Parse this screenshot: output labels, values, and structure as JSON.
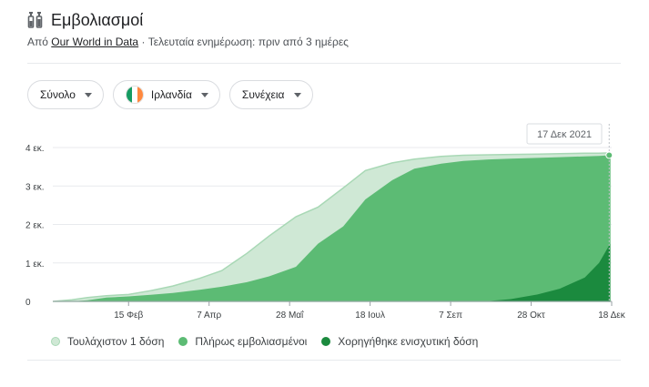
{
  "header": {
    "title": "Εμβολιασμοί",
    "subtitle_prefix": "Από ",
    "source_link": "Our World in Data",
    "subtitle_suffix": " · Τελευταία ενημέρωση: πριν από 3 ημέρες"
  },
  "controls": {
    "metric": "Σύνολο",
    "country": "Ιρλανδία",
    "mode": "Συνέχεια"
  },
  "colors": {
    "at_least_one": "#cfe8d5",
    "at_least_one_stroke": "#a8d8b5",
    "fully": "#5cbb74",
    "booster": "#1b8a3e"
  },
  "chart_data": {
    "type": "area",
    "tooltip_date": "17 Δεκ 2021",
    "y_ticks": [
      "0",
      "1 εκ.",
      "2 εκ.",
      "3 εκ.",
      "4 εκ."
    ],
    "y_tick_values": [
      0,
      1,
      2,
      3,
      4
    ],
    "ylim": [
      0,
      4
    ],
    "y_unit": "εκ.",
    "x_ticks": [
      "15 Φεβ",
      "7 Απρ",
      "28 Μαΐ",
      "18 Ιουλ",
      "7 Σεπ",
      "28 Οκτ",
      "18 Δεκ"
    ],
    "x_tick_values": [
      "2021-02-15",
      "2021-04-07",
      "2021-05-28",
      "2021-07-18",
      "2021-09-07",
      "2021-10-28",
      "2021-12-18"
    ],
    "xlim": [
      "2020-12-29",
      "2021-12-18"
    ],
    "legend_position": "bottom",
    "grid": true,
    "x": [
      "2020-12-29",
      "2021-01-10",
      "2021-01-20",
      "2021-02-01",
      "2021-02-15",
      "2021-03-01",
      "2021-03-15",
      "2021-04-01",
      "2021-04-15",
      "2021-05-01",
      "2021-05-15",
      "2021-06-01",
      "2021-06-15",
      "2021-07-01",
      "2021-07-15",
      "2021-08-01",
      "2021-08-15",
      "2021-09-01",
      "2021-09-15",
      "2021-10-01",
      "2021-10-15",
      "2021-11-01",
      "2021-11-15",
      "2021-12-01",
      "2021-12-10",
      "2021-12-17"
    ],
    "series": [
      {
        "name": "Τουλάχιστον 1 δόση",
        "values": [
          0,
          0.04,
          0.1,
          0.15,
          0.18,
          0.28,
          0.4,
          0.6,
          0.8,
          1.25,
          1.7,
          2.2,
          2.45,
          2.95,
          3.4,
          3.6,
          3.7,
          3.77,
          3.8,
          3.81,
          3.82,
          3.83,
          3.84,
          3.85,
          3.85,
          3.86
        ]
      },
      {
        "name": "Πλήρως εμβολιασμένοι",
        "values": [
          0,
          0,
          0.03,
          0.1,
          0.13,
          0.17,
          0.22,
          0.3,
          0.38,
          0.5,
          0.65,
          0.9,
          1.5,
          1.95,
          2.65,
          3.15,
          3.45,
          3.58,
          3.65,
          3.69,
          3.71,
          3.73,
          3.75,
          3.77,
          3.78,
          3.8
        ]
      },
      {
        "name": "Χορηγήθηκε ενισχυτική δόση",
        "values": [
          0,
          0,
          0,
          0,
          0,
          0,
          0,
          0,
          0,
          0,
          0,
          0,
          0,
          0,
          0,
          0,
          0,
          0,
          0,
          0.01,
          0.06,
          0.18,
          0.33,
          0.62,
          1.0,
          1.5
        ]
      }
    ]
  }
}
